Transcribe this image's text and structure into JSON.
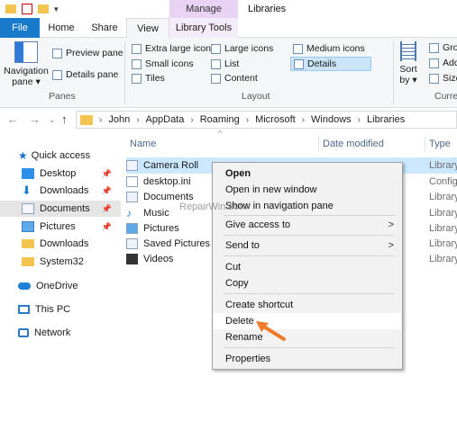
{
  "titlebar": {
    "manage_label": "Manage",
    "window_title": "Libraries"
  },
  "tabs": {
    "file": "File",
    "home": "Home",
    "share": "Share",
    "view": "View",
    "library_tools": "Library Tools"
  },
  "ribbon": {
    "panes": {
      "navigation_pane_line1": "Navigation",
      "navigation_pane_line2": "pane ▾",
      "preview_pane": "Preview pane",
      "details_pane": "Details pane",
      "group_label": "Panes"
    },
    "layout": {
      "extra_large_icons": "Extra large icons",
      "large_icons": "Large icons",
      "medium_icons": "Medium icons",
      "small_icons": "Small icons",
      "list": "List",
      "details": "Details",
      "tiles": "Tiles",
      "content": "Content",
      "group_label": "Layout"
    },
    "current_view": {
      "sort_line1": "Sort",
      "sort_line2": "by ▾",
      "group_by": "Grou",
      "add_columns": "Add",
      "size_columns": "Size",
      "group_label": "Curre"
    }
  },
  "address": {
    "crumbs": [
      "John",
      "AppData",
      "Roaming",
      "Microsoft",
      "Windows",
      "Libraries"
    ]
  },
  "nav": {
    "quick_access": "Quick access",
    "items": [
      {
        "label": "Desktop",
        "pinned": true
      },
      {
        "label": "Downloads",
        "pinned": true
      },
      {
        "label": "Documents",
        "pinned": true,
        "selected": true
      },
      {
        "label": "Pictures",
        "pinned": true
      },
      {
        "label": "Downloads",
        "pinned": false
      },
      {
        "label": "System32",
        "pinned": false
      }
    ],
    "onedrive": "OneDrive",
    "this_pc": "This PC",
    "network": "Network"
  },
  "columns": {
    "name": "Name",
    "date_modified": "Date modified",
    "type": "Type"
  },
  "files": [
    {
      "name": "Camera Roll",
      "type": "Library"
    },
    {
      "name": "desktop.ini",
      "type": "Config"
    },
    {
      "name": "Documents",
      "type": "Library"
    },
    {
      "name": "Music",
      "type": "Library"
    },
    {
      "name": "Pictures",
      "type": "Library"
    },
    {
      "name": "Saved Pictures",
      "type": "Library"
    },
    {
      "name": "Videos",
      "type": "Library"
    }
  ],
  "context_menu": {
    "open": "Open",
    "open_new_window": "Open in new window",
    "show_in_nav_pane": "Show in navigation pane",
    "give_access_to": "Give access to",
    "send_to": "Send to",
    "cut": "Cut",
    "copy": "Copy",
    "create_shortcut": "Create shortcut",
    "delete": "Delete",
    "rename": "Rename",
    "properties": "Properties"
  },
  "watermark": "RepairWin.com",
  "colors": {
    "file_tab": "#1979ca",
    "manage_tab": "#e9d3f5",
    "selection": "#cce8ff",
    "arrow": "#f07a2a"
  }
}
